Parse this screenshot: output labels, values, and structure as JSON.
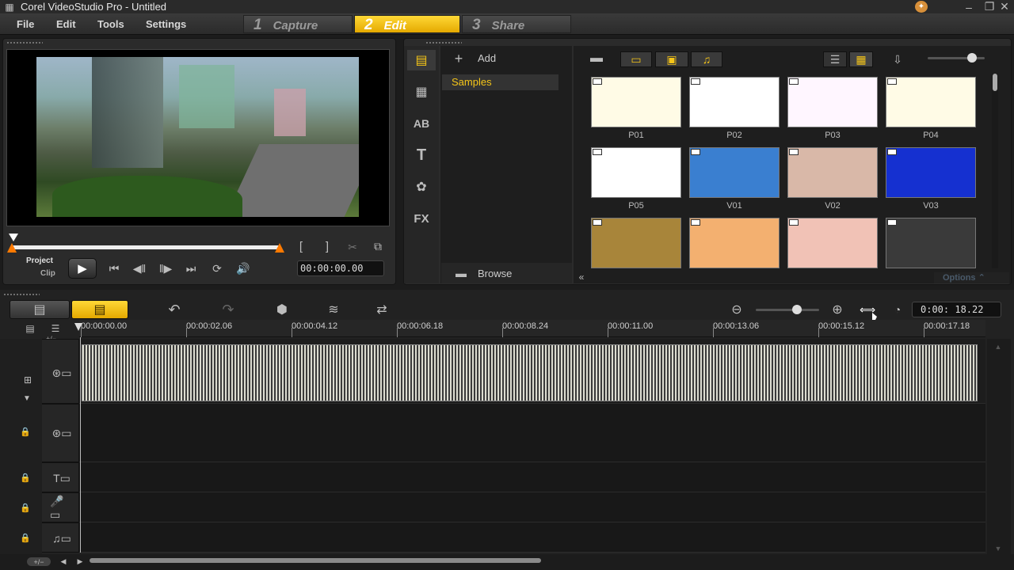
{
  "window": {
    "title": "Corel VideoStudio Pro - Untitled"
  },
  "menu": [
    "File",
    "Edit",
    "Tools",
    "Settings"
  ],
  "steps": [
    {
      "num": "1",
      "label": "Capture",
      "active": false
    },
    {
      "num": "2",
      "label": "Edit",
      "active": true
    },
    {
      "num": "3",
      "label": "Share",
      "active": false
    }
  ],
  "player": {
    "project_label": "Project",
    "clip_label": "Clip",
    "timecode": "00:00:00.00",
    "mark_in": "[",
    "mark_out": "]"
  },
  "library": {
    "add_label": "Add",
    "folders": [
      "Samples"
    ],
    "browse_label": "Browse",
    "options_label": "Options",
    "side_tabs": [
      "media-icon",
      "transition-icon",
      "AB",
      "T",
      "graphics-icon",
      "FX"
    ],
    "items": [
      {
        "label": "P01",
        "color": "#fffbe6"
      },
      {
        "label": "P02",
        "color": "#ffffff"
      },
      {
        "label": "P03",
        "color": "#fff6ff"
      },
      {
        "label": "P04",
        "color": "#fffbe6"
      },
      {
        "label": "P05",
        "color": "#ffffff"
      },
      {
        "label": "V01",
        "color": "#3a7fd0"
      },
      {
        "label": "V02",
        "color": "#d9b8a8"
      },
      {
        "label": "V03",
        "color": "#1530d0"
      },
      {
        "label": "",
        "color": "#a8853a"
      },
      {
        "label": "",
        "color": "#f3b070"
      },
      {
        "label": "",
        "color": "#f1c2b6"
      },
      {
        "label": "",
        "color": "#3a3a3a"
      }
    ]
  },
  "timeline": {
    "timecode": "0:00: 18.22",
    "ruler": [
      "00:00:00.00",
      "00:00:02.06",
      "00:00:04.12",
      "00:00:06.18",
      "00:00:08.24",
      "00:00:11.00",
      "00:00:13.06",
      "00:00:15.12",
      "00:00:17.18"
    ],
    "zoom_symbol": "+/−"
  },
  "colors": {
    "accent": "#f5c518",
    "bg": "#1c1c1c",
    "panel": "#2b2b2b"
  }
}
